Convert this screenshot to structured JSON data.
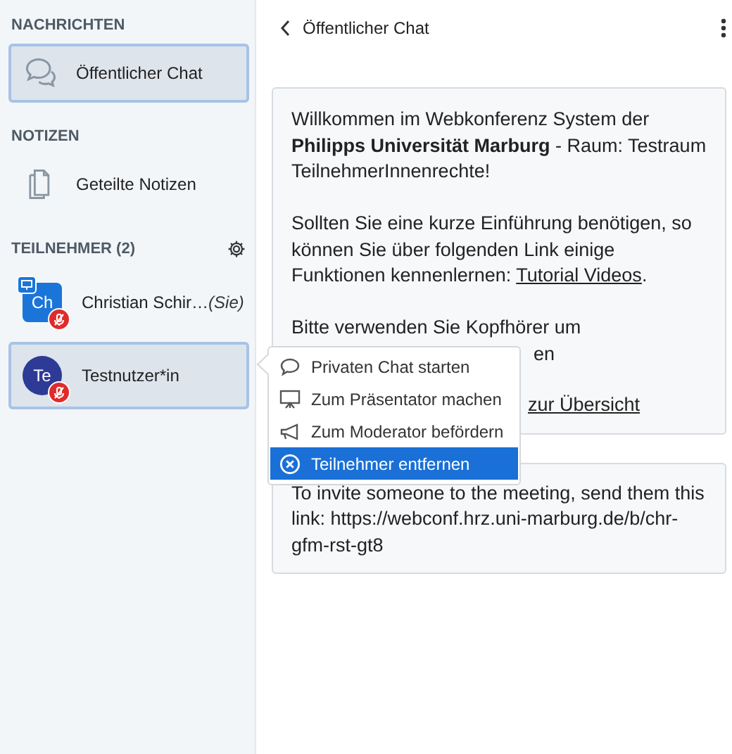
{
  "sidebar": {
    "sections": [
      {
        "title": "NACHRICHTEN",
        "items": [
          {
            "label": "Öffentlicher Chat",
            "kind": "chat",
            "selected": true
          }
        ]
      },
      {
        "title": "NOTIZEN",
        "items": [
          {
            "label": "Geteilte Notizen",
            "kind": "notes",
            "selected": false
          }
        ]
      }
    ],
    "participants": {
      "title": "TEILNEHMER (2)",
      "users": [
        {
          "initials": "Ch",
          "name": "Christian Schir…",
          "suffix": "(Sie)",
          "kind": "moderator",
          "color": "#1b75d8",
          "presenter": true,
          "muted": true,
          "selected": false
        },
        {
          "initials": "Te",
          "name": "Testnutzer*in",
          "kind": "viewer",
          "color": "#2d3a96",
          "presenter": false,
          "muted": true,
          "selected": true
        }
      ]
    }
  },
  "chat": {
    "title": "Öffentlicher Chat",
    "messages": [
      {
        "blocks": [
          {
            "kind": "paragraph",
            "parts": [
              {
                "text": "Willkommen im Webkonferenz System der **Philipps Universität Marburg** - Raum: Testraum TeilnehmerInnenrechte!"
              }
            ]
          },
          {
            "kind": "paragraph",
            "parts": [
              {
                "text": "Sollten Sie eine kurze Einführung benötigen, so können Sie über folgenden Link einige Funktionen kennenlernen: "
              },
              {
                "link": "Tutorial Videos"
              },
              {
                "text": "."
              }
            ]
          },
          {
            "kind": "line",
            "text": "Bitte verwenden Sie Kopfhörer um"
          },
          {
            "kind": "covered-tail",
            "text": "en"
          },
          {
            "kind": "covered-link",
            "text": "zur Übersicht"
          }
        ]
      },
      {
        "blocks": [
          {
            "kind": "paragraph",
            "parts": [
              {
                "text": "To invite someone to the meeting, send them this link: https://webconf.hrz.uni-marburg.de/b/chr-gfm-rst-gt8"
              }
            ]
          }
        ]
      }
    ]
  },
  "menu": {
    "items": [
      {
        "label": "Privaten Chat starten",
        "kind": "chat",
        "selected": false
      },
      {
        "label": "Zum Präsentator machen",
        "kind": "presenter",
        "selected": false
      },
      {
        "label": "Zum Moderator befördern",
        "kind": "moderator",
        "selected": false
      },
      {
        "label": "Teilnehmer entfernen",
        "kind": "remove",
        "selected": true
      }
    ]
  }
}
